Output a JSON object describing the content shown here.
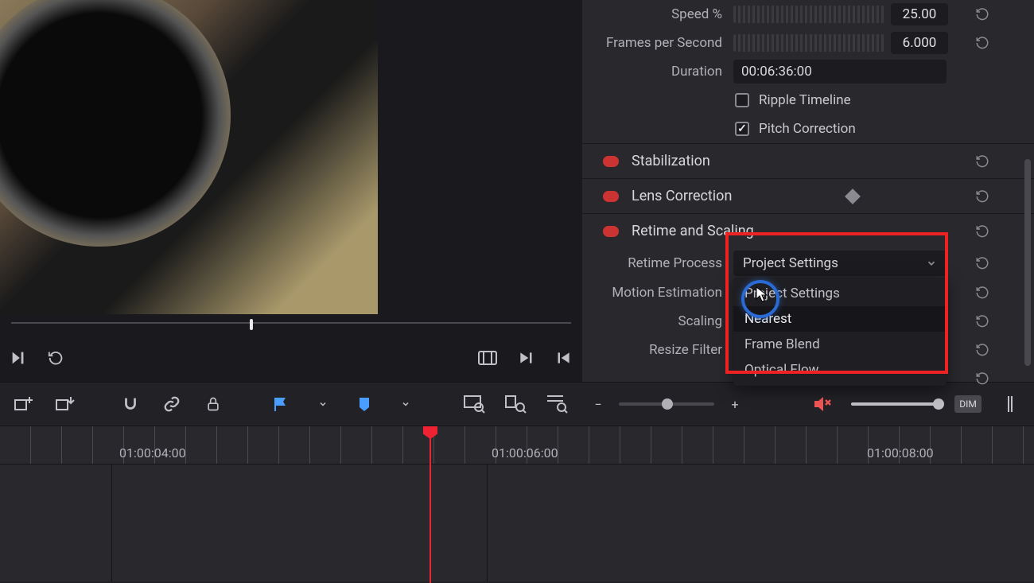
{
  "inspector": {
    "speed": {
      "label": "Speed %",
      "value": "25.00"
    },
    "fps": {
      "label": "Frames per Second",
      "value": "6.000"
    },
    "duration": {
      "label": "Duration",
      "value": "00:06:36:00"
    },
    "ripple": {
      "label": "Ripple Timeline",
      "checked": false
    },
    "pitch": {
      "label": "Pitch Correction",
      "checked": true
    },
    "sections": {
      "stabilization": "Stabilization",
      "lens": "Lens Correction",
      "retime": "Retime and Scaling"
    },
    "retime": {
      "process": {
        "label": "Retime Process",
        "value": "Project Settings",
        "options": [
          "Project Settings",
          "Nearest",
          "Frame Blend",
          "Optical Flow"
        ],
        "hover_index": 1
      },
      "motion": {
        "label": "Motion Estimation"
      },
      "scaling": {
        "label": "Scaling"
      },
      "resize": {
        "label": "Resize Filter"
      }
    }
  },
  "timeline": {
    "tc1": "01:00:04:00",
    "tc2": "01:00:06:00",
    "tc3": "01:00:08:00"
  },
  "toolbar": {
    "dim": "DIM"
  }
}
